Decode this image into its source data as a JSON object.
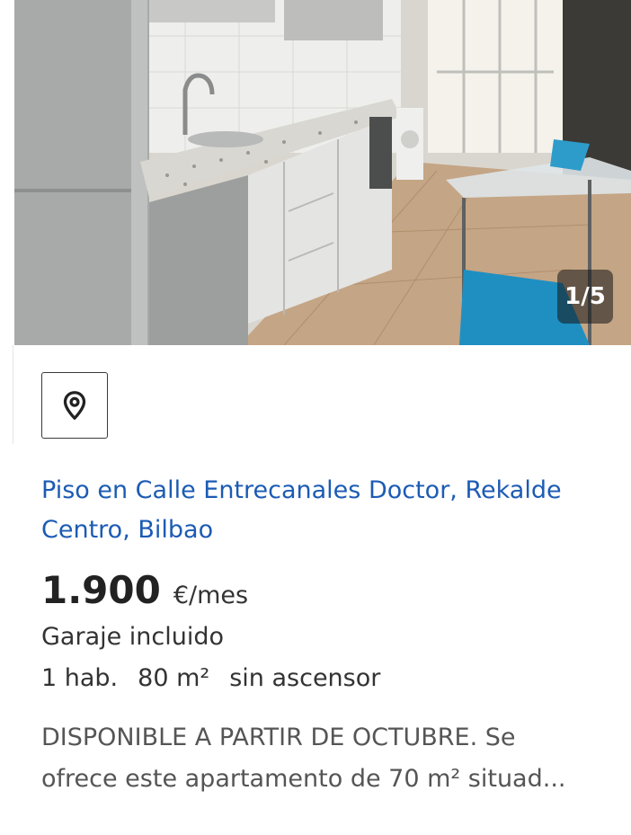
{
  "gallery": {
    "counter": "1/5",
    "photo_alt": "kitchen photo"
  },
  "map_button": {
    "icon": "map-pin-icon"
  },
  "listing": {
    "title": "Piso en Calle Entrecanales Doctor, Rekalde Centro, Bilbao",
    "price": "1.900",
    "price_unit": "€/mes",
    "garage": "Garaje incluido",
    "features": {
      "rooms": "1 hab.",
      "area": "80 m²",
      "elevator": "sin ascensor"
    },
    "description_line1": "DISPONIBLE A PARTIR DE OCTUBRE. Se",
    "description_line2": "ofrece este apartamento de 70 m² situad..."
  },
  "colors": {
    "title_blue": "#1c5bb4",
    "text_dark": "#222222",
    "text_muted": "#555555"
  }
}
